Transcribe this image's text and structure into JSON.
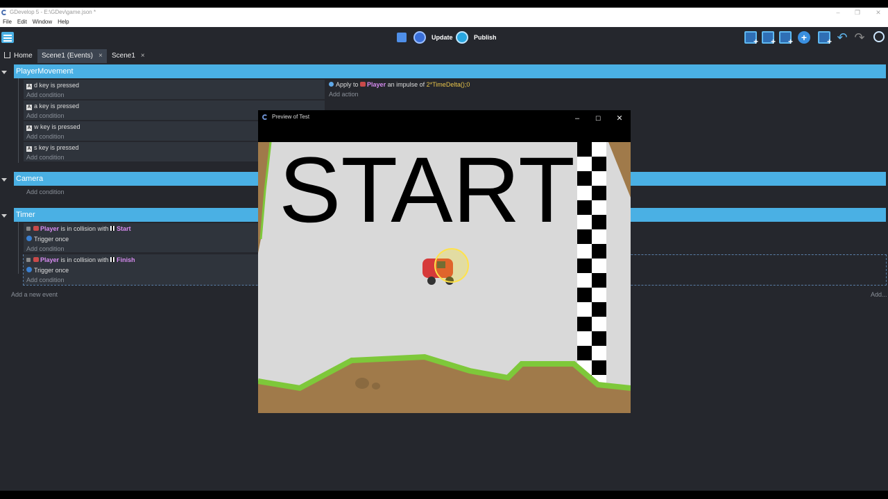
{
  "window": {
    "title": "GDevelop 5 - E:\\GDev\\game.json *"
  },
  "menu": [
    "File",
    "Edit",
    "Window",
    "Help"
  ],
  "toolbar": {
    "update_label": "Update",
    "publish_label": "Publish"
  },
  "tabs": [
    {
      "label": "Home"
    },
    {
      "label": "Scene1 (Events)",
      "close": "×"
    },
    {
      "label": "Scene1",
      "close": "×"
    }
  ],
  "events": {
    "groups": [
      {
        "name": "PlayerMovement"
      },
      {
        "name": "Camera"
      },
      {
        "name": "Timer"
      }
    ],
    "player_movement": [
      {
        "key_letter": "d",
        "text": "key is pressed",
        "add": "Add condition"
      },
      {
        "key_letter": "a",
        "text": "key is pressed",
        "add": "Add condition"
      },
      {
        "key_letter": "w",
        "text": "key is pressed",
        "add": "Add condition"
      },
      {
        "key_letter": "s",
        "text": "key is pressed",
        "add": "Add condition"
      }
    ],
    "action": {
      "prefix": "Apply to",
      "object": "Player",
      "middle": "an impulse of",
      "expression": "2*TimeDelta();0",
      "add": "Add action"
    },
    "camera_add": "Add condition",
    "timer": [
      {
        "object": "Player",
        "text": "is in collision with",
        "target": "Start",
        "trigger": "Trigger once",
        "add": "Add condition"
      },
      {
        "object": "Player",
        "text": "is in collision with",
        "target": "Finish",
        "trigger": "Trigger once",
        "add": "Add condition"
      }
    ],
    "add_event": "Add a new event",
    "add_right": "Add..."
  },
  "preview": {
    "title": "Preview of Test",
    "game_text": "START"
  },
  "colors": {
    "group_bar": "#4ab0e4",
    "object_name": "#d68bf0",
    "expression": "#e8c44a",
    "ground": "#a07a4a",
    "grass": "#7ec83a",
    "sky": "#d9d9d9"
  }
}
